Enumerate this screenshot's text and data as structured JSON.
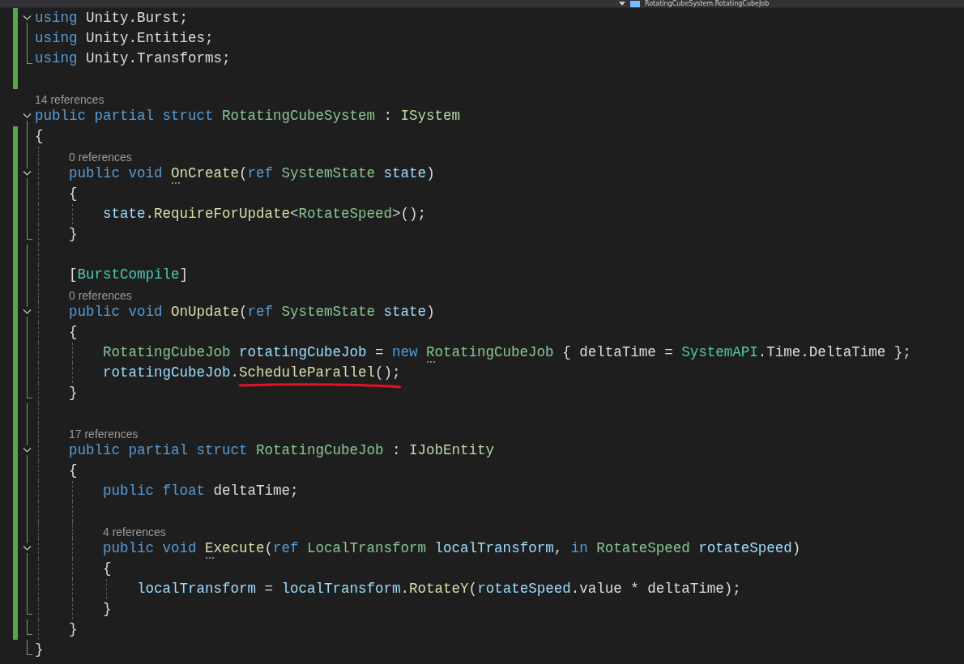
{
  "breadcrumb": {
    "text": "RotatingCubeSystem.RotatingCubeJob"
  },
  "lines": [
    {
      "kind": "code",
      "changed": true,
      "expanded": true,
      "tokens": [
        {
          "t": "using ",
          "kind": "keyword"
        },
        {
          "t": "Unity.Burst;",
          "kind": "plain"
        }
      ]
    },
    {
      "kind": "code",
      "changed": true,
      "tokens": [
        {
          "t": "using ",
          "kind": "keyword"
        },
        {
          "t": "Unity.Entities;",
          "kind": "plain"
        }
      ]
    },
    {
      "kind": "code",
      "changed": true,
      "fold_end": true,
      "tokens": [
        {
          "t": "using ",
          "kind": "keyword"
        },
        {
          "t": "Unity.Transforms;",
          "kind": "plain"
        }
      ]
    },
    {
      "kind": "blank",
      "changed": true
    },
    {
      "kind": "lens",
      "changed": false,
      "text": "14 references"
    },
    {
      "kind": "code",
      "changed": false,
      "expanded": true,
      "tokens": [
        {
          "t": "public partial struct ",
          "kind": "keyword"
        },
        {
          "t": "RotatingCubeSystem",
          "kind": "struct"
        },
        {
          "t": " : ",
          "kind": "plain"
        },
        {
          "t": "ISystem",
          "kind": "interface"
        }
      ]
    },
    {
      "kind": "code",
      "changed": true,
      "tokens": [
        {
          "t": "{",
          "kind": "plain"
        }
      ]
    },
    {
      "kind": "block",
      "children": [
        {
          "kind": "lens",
          "changed": true,
          "text": "0 references"
        },
        {
          "kind": "code",
          "changed": true,
          "expanded": true,
          "tokens": [
            {
              "t": "public void ",
              "kind": "keyword"
            },
            {
              "t": "OnCreate",
              "kind": "method",
              "hint": true
            },
            {
              "t": "(",
              "kind": "plain"
            },
            {
              "t": "ref ",
              "kind": "keyword"
            },
            {
              "t": "SystemState",
              "kind": "struct"
            },
            {
              "t": " state",
              "kind": "local"
            },
            {
              "t": ")",
              "kind": "plain"
            }
          ]
        },
        {
          "kind": "code",
          "changed": true,
          "tokens": [
            {
              "t": "{",
              "kind": "plain"
            }
          ]
        },
        {
          "kind": "block",
          "children": [
            {
              "kind": "code",
              "changed": true,
              "tokens": [
                {
                  "t": "state",
                  "kind": "local"
                },
                {
                  "t": ".",
                  "kind": "plain"
                },
                {
                  "t": "RequireForUpdate",
                  "kind": "method"
                },
                {
                  "t": "<",
                  "kind": "plain"
                },
                {
                  "t": "RotateSpeed",
                  "kind": "struct"
                },
                {
                  "t": ">();",
                  "kind": "plain"
                }
              ]
            }
          ]
        },
        {
          "kind": "code",
          "changed": true,
          "fold_end": true,
          "tokens": [
            {
              "t": "}",
              "kind": "plain"
            }
          ]
        },
        {
          "kind": "blank",
          "changed": true
        },
        {
          "kind": "code",
          "changed": true,
          "tokens": [
            {
              "t": "[",
              "kind": "plain"
            },
            {
              "t": "BurstCompile",
              "kind": "class"
            },
            {
              "t": "]",
              "kind": "plain"
            }
          ]
        },
        {
          "kind": "lens",
          "changed": true,
          "text": "0 references"
        },
        {
          "kind": "code",
          "changed": true,
          "expanded": true,
          "tokens": [
            {
              "t": "public void ",
              "kind": "keyword"
            },
            {
              "t": "OnUpdate",
              "kind": "method"
            },
            {
              "t": "(",
              "kind": "plain"
            },
            {
              "t": "ref ",
              "kind": "keyword"
            },
            {
              "t": "SystemState",
              "kind": "struct"
            },
            {
              "t": " state",
              "kind": "local"
            },
            {
              "t": ")",
              "kind": "plain"
            }
          ]
        },
        {
          "kind": "code",
          "changed": true,
          "tokens": [
            {
              "t": "{",
              "kind": "plain"
            }
          ]
        },
        {
          "kind": "block",
          "children": [
            {
              "kind": "code",
              "changed": true,
              "tokens": [
                {
                  "t": "RotatingCubeJob",
                  "kind": "struct"
                },
                {
                  "t": " rotatingCubeJob",
                  "kind": "local"
                },
                {
                  "t": " = ",
                  "kind": "plain"
                },
                {
                  "t": "new ",
                  "kind": "keyword"
                },
                {
                  "t": "RotatingCubeJob",
                  "kind": "struct",
                  "hint": true
                },
                {
                  "t": " { deltaTime = ",
                  "kind": "plain"
                },
                {
                  "t": "SystemAPI",
                  "kind": "class"
                },
                {
                  "t": ".Time.DeltaTime };",
                  "kind": "plain"
                }
              ]
            },
            {
              "kind": "code",
              "changed": true,
              "tokens": [
                {
                  "t": "rotatingCubeJob",
                  "kind": "local"
                },
                {
                  "t": ".",
                  "kind": "plain"
                },
                {
                  "t": "ScheduleParallel",
                  "kind": "method",
                  "underlined": true
                },
                {
                  "t": "();",
                  "kind": "plain",
                  "underlined": true
                }
              ]
            }
          ]
        },
        {
          "kind": "code",
          "changed": true,
          "fold_end": true,
          "tokens": [
            {
              "t": "}",
              "kind": "plain"
            }
          ]
        },
        {
          "kind": "blank",
          "changed": true
        },
        {
          "kind": "lens",
          "changed": true,
          "text": "17 references"
        },
        {
          "kind": "code",
          "changed": true,
          "expanded": true,
          "tokens": [
            {
              "t": "public partial struct ",
              "kind": "keyword"
            },
            {
              "t": "RotatingCubeJob",
              "kind": "struct"
            },
            {
              "t": " : ",
              "kind": "plain"
            },
            {
              "t": "IJobEntity",
              "kind": "interface"
            }
          ]
        },
        {
          "kind": "code",
          "changed": true,
          "tokens": [
            {
              "t": "{",
              "kind": "plain"
            }
          ]
        },
        {
          "kind": "block",
          "children": [
            {
              "kind": "code",
              "changed": true,
              "tokens": [
                {
                  "t": "public float ",
                  "kind": "keyword"
                },
                {
                  "t": "deltaTime;",
                  "kind": "plain"
                }
              ]
            },
            {
              "kind": "blank",
              "changed": true
            },
            {
              "kind": "lens",
              "changed": true,
              "text": "4 references"
            },
            {
              "kind": "code",
              "changed": true,
              "expanded": true,
              "tokens": [
                {
                  "t": "public void ",
                  "kind": "keyword"
                },
                {
                  "t": "Execute",
                  "kind": "method",
                  "hint": true
                },
                {
                  "t": "(",
                  "kind": "plain"
                },
                {
                  "t": "ref ",
                  "kind": "keyword"
                },
                {
                  "t": "LocalTransform",
                  "kind": "struct"
                },
                {
                  "t": " localTransform",
                  "kind": "local"
                },
                {
                  "t": ", ",
                  "kind": "plain"
                },
                {
                  "t": "in ",
                  "kind": "keyword"
                },
                {
                  "t": "RotateSpeed",
                  "kind": "struct"
                },
                {
                  "t": " rotateSpeed",
                  "kind": "local"
                },
                {
                  "t": ")",
                  "kind": "plain"
                }
              ]
            },
            {
              "kind": "code",
              "changed": true,
              "tokens": [
                {
                  "t": "{",
                  "kind": "plain"
                }
              ]
            },
            {
              "kind": "block",
              "children": [
                {
                  "kind": "code",
                  "changed": true,
                  "tokens": [
                    {
                      "t": "localTransform",
                      "kind": "local"
                    },
                    {
                      "t": " = ",
                      "kind": "plain"
                    },
                    {
                      "t": "localTransform",
                      "kind": "local"
                    },
                    {
                      "t": ".",
                      "kind": "plain"
                    },
                    {
                      "t": "RotateY",
                      "kind": "method"
                    },
                    {
                      "t": "(",
                      "kind": "plain"
                    },
                    {
                      "t": "rotateSpeed",
                      "kind": "local"
                    },
                    {
                      "t": ".value * deltaTime);",
                      "kind": "plain"
                    }
                  ]
                }
              ]
            },
            {
              "kind": "code",
              "changed": true,
              "fold_end": true,
              "tokens": [
                {
                  "t": "}",
                  "kind": "plain"
                }
              ]
            }
          ]
        },
        {
          "kind": "code",
          "changed": true,
          "fold_end": true,
          "tokens": [
            {
              "t": "}",
              "kind": "plain"
            }
          ]
        }
      ]
    },
    {
      "kind": "code",
      "changed": false,
      "fold_end": true,
      "tokens": [
        {
          "t": "}",
          "kind": "plain"
        }
      ]
    }
  ]
}
